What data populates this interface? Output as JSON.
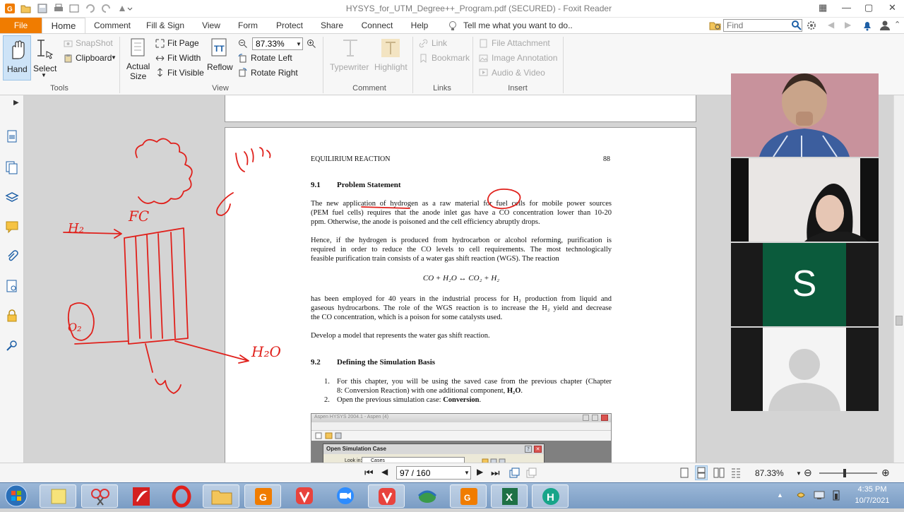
{
  "window": {
    "title": "HYSYS_for_UTM_Degree++_Program.pdf (SECURED) - Foxit Reader"
  },
  "ribbon_tabs": {
    "file": "File",
    "home": "Home",
    "comment": "Comment",
    "fill_sign": "Fill & Sign",
    "view": "View",
    "form": "Form",
    "protect": "Protect",
    "share": "Share",
    "connect": "Connect",
    "help": "Help",
    "tell_me": "Tell me what you want to do..",
    "find_placeholder": "Find"
  },
  "ribbon": {
    "hand": "Hand",
    "select": "Select",
    "snapshot": "SnapShot",
    "clipboard": "Clipboard",
    "actual_size_1": "Actual",
    "actual_size_2": "Size",
    "fit_page": "Fit Page",
    "fit_width": "Fit Width",
    "fit_visible": "Fit Visible",
    "reflow": "Reflow",
    "zoom": "87.33%",
    "rotate_left": "Rotate Left",
    "rotate_right": "Rotate Right",
    "typewriter": "Typewriter",
    "highlight": "Highlight",
    "link": "Link",
    "bookmark": "Bookmark",
    "file_attachment": "File Attachment",
    "image_annotation": "Image Annotation",
    "audio_video": "Audio & Video",
    "groups": {
      "tools": "Tools",
      "view": "View",
      "comment": "Comment",
      "links": "Links",
      "insert": "Insert"
    }
  },
  "document": {
    "running_header": "EQUILIRIUM REACTION",
    "page_number": "88",
    "s1_num": "9.1",
    "s1_title": "Problem Statement",
    "p1": [
      "The new application of hydrogen as a raw material for fuel cells for mobile power sources",
      "(PEM fuel cells) requires that the anode inlet gas have a CO concentration lower than 10-20",
      "ppm. Otherwise, the anode is poisoned and the cell efficiency abruptly drops."
    ],
    "p2": [
      "Hence, if the hydrogen is produced from hydrocarbon or alcohol reforming, purification is",
      "required in order to reduce the CO levels to cell requirements. The most technologically",
      "feasible purification train consists of a water gas shift reaction (WGS). The reaction"
    ],
    "equation": "CO + H₂O ↔ CO₂ + H₂",
    "p3": [
      "has been employed for 40 years in the industrial process for H₂ production from liquid and",
      "gaseous hydrocarbons. The role of the WGS reaction is to increase the H₂ yield and decrease",
      "the CO concentration, which is a poison for some catalysts used."
    ],
    "p4": "Develop a model that represents the water gas shift reaction.",
    "s2_num": "9.2",
    "s2_title": "Defining the Simulation Basis",
    "list": [
      {
        "num": "1.",
        "line1": "For this chapter, you will be using the saved case from the previous chapter (Chapter",
        "line2a": "8: Conversion Reaction) with one additional component, ",
        "line2b": "H₂O",
        "line2c": "."
      },
      {
        "num": "2.",
        "line1a": "Open the previous simulation case: ",
        "line1b": "Conversion",
        "line1c": "."
      }
    ],
    "embedded": {
      "app_title": "Aspen HYSYS 2004.1 - Aspen (4)",
      "dialog_title": "Open Simulation Case",
      "look_in_label": "Look in:",
      "look_in_value": "Cases"
    }
  },
  "status": {
    "page_field": "97 / 160",
    "zoom": "87.33%"
  },
  "participants": [
    {
      "kind": "video",
      "name": "participant-1"
    },
    {
      "kind": "video",
      "name": "participant-2"
    },
    {
      "kind": "initial",
      "initial": "S",
      "color": "#0b5b3c"
    },
    {
      "kind": "placeholder"
    }
  ],
  "taskbar": {
    "time": "4:35 PM",
    "date": "10/7/2021"
  },
  "annotations": {
    "fc": "FC",
    "h2": "H₂",
    "h2o": "H₂O",
    "o2": "O₂"
  },
  "colors": {
    "file_tab": "#f07c00",
    "ink": "#e0201b",
    "participant_s": "#0b5b3c"
  }
}
